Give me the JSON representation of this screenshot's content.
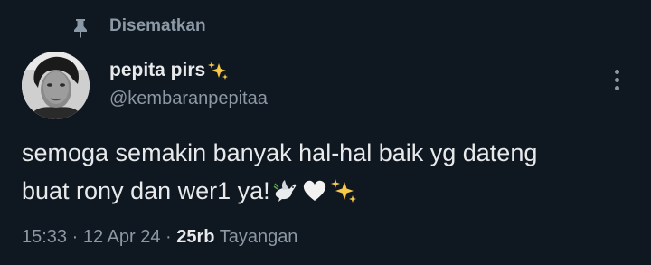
{
  "pinned": {
    "icon": "pin-icon",
    "label": "Disematkan"
  },
  "author": {
    "display_name": "pepita pirs",
    "display_name_emoji": "sparkles-emoji",
    "handle": "@kembaranpepitaa",
    "avatar": "avatar-photo"
  },
  "more_menu_icon": "more-vertical-icon",
  "tweet": {
    "line1": "semoga semakin banyak hal-hal baik yg dateng",
    "line2": "buat rony dan wer1 ya!",
    "emojis": [
      "dove-emoji",
      "white-heart-emoji",
      "sparkles-emoji"
    ]
  },
  "meta": {
    "time": "15:33",
    "sep1": " · ",
    "date": "12 Apr 24",
    "sep2": " · ",
    "views_count": "25rb",
    "views_label": " Tayangan"
  },
  "colors": {
    "background": "#0f1720",
    "primary_text": "#e7e9ea",
    "secondary_text": "#8b98a5",
    "sparkle": "#f7c948"
  }
}
